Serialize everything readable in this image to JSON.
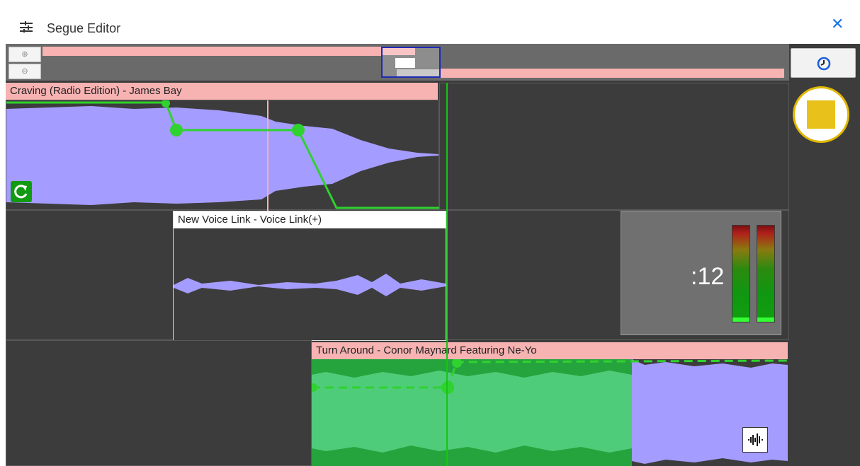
{
  "window": {
    "title": "Segue Editor",
    "close_glyph": "✕",
    "settings_icon": "sliders-icon"
  },
  "overview": {
    "zoom_in_glyph": "⊕",
    "zoom_out_glyph": "⊖",
    "clock_icon": "clock-icon"
  },
  "tracks": [
    {
      "title": "Craving (Radio Edition) - James Bay",
      "color": "#f7b2b2",
      "wave_color": "#a59cff",
      "refresh_icon": "refresh-icon"
    },
    {
      "title": "New Voice Link - Voice Link(+)",
      "color": "#ffffff",
      "wave_color": "#a59cff"
    },
    {
      "title": "Turn Around - Conor Maynard Featuring Ne-Yo",
      "color": "#f7b2b2",
      "wave_color": "#a59cff",
      "selected_color": "#4fcc7a",
      "waveform_icon": "waveform-icon"
    }
  ],
  "meter": {
    "time": ":12"
  },
  "stop_button": {
    "icon": "stop-icon",
    "color": "#e8c21a"
  },
  "colors": {
    "envelope": "#2fd22f",
    "playhead": "#17c417",
    "background": "#3c3c3c"
  }
}
